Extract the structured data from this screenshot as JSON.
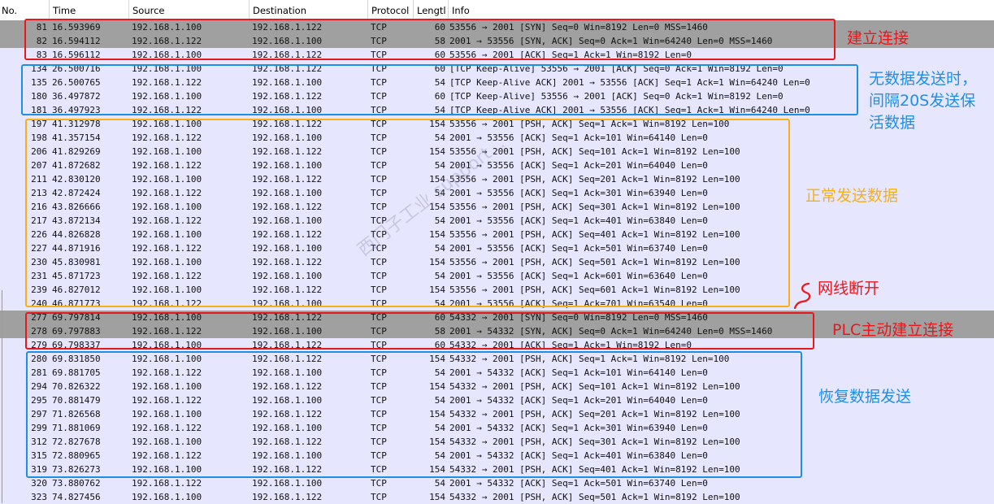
{
  "columns": {
    "no": "No.",
    "time": "Time",
    "source": "Source",
    "destination": "Destination",
    "protocol": "Protocol",
    "length": "Lengtl",
    "info": "Info"
  },
  "rows": [
    {
      "no": "81",
      "time": "16.593969",
      "source": "192.168.1.100",
      "destination": "192.168.1.122",
      "protocol": "TCP",
      "length": "60",
      "info": "53556 → 2001 [SYN] Seq=0 Win=8192 Len=0 MSS=1460",
      "style": "syn"
    },
    {
      "no": "82",
      "time": "16.594112",
      "source": "192.168.1.122",
      "destination": "192.168.1.100",
      "protocol": "TCP",
      "length": "58",
      "info": "2001 → 53556 [SYN, ACK] Seq=0 Ack=1 Win=64240 Len=0 MSS=1460",
      "style": "syn"
    },
    {
      "no": "83",
      "time": "16.596112",
      "source": "192.168.1.100",
      "destination": "192.168.1.122",
      "protocol": "TCP",
      "length": "60",
      "info": "53556 → 2001 [ACK] Seq=1 Ack=1 Win=8192 Len=0",
      "style": "tcp"
    },
    {
      "no": "134",
      "time": "26.500716",
      "source": "192.168.1.100",
      "destination": "192.168.1.122",
      "protocol": "TCP",
      "length": "60",
      "info": "[TCP Keep-Alive] 53556 → 2001 [ACK] Seq=0 Ack=1 Win=8192 Len=0",
      "style": "ka"
    },
    {
      "no": "135",
      "time": "26.500765",
      "source": "192.168.1.122",
      "destination": "192.168.1.100",
      "protocol": "TCP",
      "length": "54",
      "info": "[TCP Keep-Alive ACK] 2001 → 53556 [ACK] Seq=1 Ack=1 Win=64240 Len=0",
      "style": "ka"
    },
    {
      "no": "180",
      "time": "36.497872",
      "source": "192.168.1.100",
      "destination": "192.168.1.122",
      "protocol": "TCP",
      "length": "60",
      "info": "[TCP Keep-Alive] 53556 → 2001 [ACK] Seq=0 Ack=1 Win=8192 Len=0",
      "style": "ka"
    },
    {
      "no": "181",
      "time": "36.497923",
      "source": "192.168.1.122",
      "destination": "192.168.1.100",
      "protocol": "TCP",
      "length": "54",
      "info": "[TCP Keep-Alive ACK] 2001 → 53556 [ACK] Seq=1 Ack=1 Win=64240 Len=0",
      "style": "ka"
    },
    {
      "no": "197",
      "time": "41.312978",
      "source": "192.168.1.100",
      "destination": "192.168.1.122",
      "protocol": "TCP",
      "length": "154",
      "info": "53556 → 2001 [PSH, ACK] Seq=1 Ack=1 Win=8192 Len=100",
      "style": "tcp"
    },
    {
      "no": "198",
      "time": "41.357154",
      "source": "192.168.1.122",
      "destination": "192.168.1.100",
      "protocol": "TCP",
      "length": "54",
      "info": "2001 → 53556 [ACK] Seq=1 Ack=101 Win=64140 Len=0",
      "style": "tcp"
    },
    {
      "no": "206",
      "time": "41.829269",
      "source": "192.168.1.100",
      "destination": "192.168.1.122",
      "protocol": "TCP",
      "length": "154",
      "info": "53556 → 2001 [PSH, ACK] Seq=101 Ack=1 Win=8192 Len=100",
      "style": "tcp"
    },
    {
      "no": "207",
      "time": "41.872682",
      "source": "192.168.1.122",
      "destination": "192.168.1.100",
      "protocol": "TCP",
      "length": "54",
      "info": "2001 → 53556 [ACK] Seq=1 Ack=201 Win=64040 Len=0",
      "style": "tcp"
    },
    {
      "no": "211",
      "time": "42.830120",
      "source": "192.168.1.100",
      "destination": "192.168.1.122",
      "protocol": "TCP",
      "length": "154",
      "info": "53556 → 2001 [PSH, ACK] Seq=201 Ack=1 Win=8192 Len=100",
      "style": "tcp"
    },
    {
      "no": "213",
      "time": "42.872424",
      "source": "192.168.1.122",
      "destination": "192.168.1.100",
      "protocol": "TCP",
      "length": "54",
      "info": "2001 → 53556 [ACK] Seq=1 Ack=301 Win=63940 Len=0",
      "style": "tcp"
    },
    {
      "no": "216",
      "time": "43.826666",
      "source": "192.168.1.100",
      "destination": "192.168.1.122",
      "protocol": "TCP",
      "length": "154",
      "info": "53556 → 2001 [PSH, ACK] Seq=301 Ack=1 Win=8192 Len=100",
      "style": "tcp"
    },
    {
      "no": "217",
      "time": "43.872134",
      "source": "192.168.1.122",
      "destination": "192.168.1.100",
      "protocol": "TCP",
      "length": "54",
      "info": "2001 → 53556 [ACK] Seq=1 Ack=401 Win=63840 Len=0",
      "style": "tcp"
    },
    {
      "no": "226",
      "time": "44.826828",
      "source": "192.168.1.100",
      "destination": "192.168.1.122",
      "protocol": "TCP",
      "length": "154",
      "info": "53556 → 2001 [PSH, ACK] Seq=401 Ack=1 Win=8192 Len=100",
      "style": "tcp"
    },
    {
      "no": "227",
      "time": "44.871916",
      "source": "192.168.1.122",
      "destination": "192.168.1.100",
      "protocol": "TCP",
      "length": "54",
      "info": "2001 → 53556 [ACK] Seq=1 Ack=501 Win=63740 Len=0",
      "style": "tcp"
    },
    {
      "no": "230",
      "time": "45.830981",
      "source": "192.168.1.100",
      "destination": "192.168.1.122",
      "protocol": "TCP",
      "length": "154",
      "info": "53556 → 2001 [PSH, ACK] Seq=501 Ack=1 Win=8192 Len=100",
      "style": "tcp"
    },
    {
      "no": "231",
      "time": "45.871723",
      "source": "192.168.1.122",
      "destination": "192.168.1.100",
      "protocol": "TCP",
      "length": "54",
      "info": "2001 → 53556 [ACK] Seq=1 Ack=601 Win=63640 Len=0",
      "style": "tcp"
    },
    {
      "no": "239",
      "time": "46.827012",
      "source": "192.168.1.100",
      "destination": "192.168.1.122",
      "protocol": "TCP",
      "length": "154",
      "info": "53556 → 2001 [PSH, ACK] Seq=601 Ack=1 Win=8192 Len=100",
      "style": "tcp"
    },
    {
      "no": "240",
      "time": "46.871773",
      "source": "192.168.1.122",
      "destination": "192.168.1.100",
      "protocol": "TCP",
      "length": "54",
      "info": "2001 → 53556 [ACK] Seq=1 Ack=701 Win=63540 Len=0",
      "style": "tcp"
    },
    {
      "no": "277",
      "time": "69.797814",
      "source": "192.168.1.100",
      "destination": "192.168.1.122",
      "protocol": "TCP",
      "length": "60",
      "info": "54332 → 2001 [SYN] Seq=0 Win=8192 Len=0 MSS=1460",
      "style": "syn"
    },
    {
      "no": "278",
      "time": "69.797883",
      "source": "192.168.1.122",
      "destination": "192.168.1.100",
      "protocol": "TCP",
      "length": "58",
      "info": "2001 → 54332 [SYN, ACK] Seq=0 Ack=1 Win=64240 Len=0 MSS=1460",
      "style": "syn"
    },
    {
      "no": "279",
      "time": "69.798337",
      "source": "192.168.1.100",
      "destination": "192.168.1.122",
      "protocol": "TCP",
      "length": "60",
      "info": "54332 → 2001 [ACK] Seq=1 Ack=1 Win=8192 Len=0",
      "style": "tcp"
    },
    {
      "no": "280",
      "time": "69.831850",
      "source": "192.168.1.100",
      "destination": "192.168.1.122",
      "protocol": "TCP",
      "length": "154",
      "info": "54332 → 2001 [PSH, ACK] Seq=1 Ack=1 Win=8192 Len=100",
      "style": "tcp"
    },
    {
      "no": "281",
      "time": "69.881705",
      "source": "192.168.1.122",
      "destination": "192.168.1.100",
      "protocol": "TCP",
      "length": "54",
      "info": "2001 → 54332 [ACK] Seq=1 Ack=101 Win=64140 Len=0",
      "style": "tcp"
    },
    {
      "no": "294",
      "time": "70.826322",
      "source": "192.168.1.100",
      "destination": "192.168.1.122",
      "protocol": "TCP",
      "length": "154",
      "info": "54332 → 2001 [PSH, ACK] Seq=101 Ack=1 Win=8192 Len=100",
      "style": "tcp"
    },
    {
      "no": "295",
      "time": "70.881479",
      "source": "192.168.1.122",
      "destination": "192.168.1.100",
      "protocol": "TCP",
      "length": "54",
      "info": "2001 → 54332 [ACK] Seq=1 Ack=201 Win=64040 Len=0",
      "style": "tcp"
    },
    {
      "no": "297",
      "time": "71.826568",
      "source": "192.168.1.100",
      "destination": "192.168.1.122",
      "protocol": "TCP",
      "length": "154",
      "info": "54332 → 2001 [PSH, ACK] Seq=201 Ack=1 Win=8192 Len=100",
      "style": "tcp"
    },
    {
      "no": "299",
      "time": "71.881069",
      "source": "192.168.1.122",
      "destination": "192.168.1.100",
      "protocol": "TCP",
      "length": "54",
      "info": "2001 → 54332 [ACK] Seq=1 Ack=301 Win=63940 Len=0",
      "style": "tcp"
    },
    {
      "no": "312",
      "time": "72.827678",
      "source": "192.168.1.100",
      "destination": "192.168.1.122",
      "protocol": "TCP",
      "length": "154",
      "info": "54332 → 2001 [PSH, ACK] Seq=301 Ack=1 Win=8192 Len=100",
      "style": "tcp"
    },
    {
      "no": "315",
      "time": "72.880965",
      "source": "192.168.1.122",
      "destination": "192.168.1.100",
      "protocol": "TCP",
      "length": "54",
      "info": "2001 → 54332 [ACK] Seq=1 Ack=401 Win=63840 Len=0",
      "style": "tcp"
    },
    {
      "no": "319",
      "time": "73.826273",
      "source": "192.168.1.100",
      "destination": "192.168.1.122",
      "protocol": "TCP",
      "length": "154",
      "info": "54332 → 2001 [PSH, ACK] Seq=401 Ack=1 Win=8192 Len=100",
      "style": "tcp"
    },
    {
      "no": "320",
      "time": "73.880762",
      "source": "192.168.1.122",
      "destination": "192.168.1.100",
      "protocol": "TCP",
      "length": "54",
      "info": "2001 → 54332 [ACK] Seq=1 Ack=501 Win=63740 Len=0",
      "style": "tcp"
    },
    {
      "no": "323",
      "time": "74.827456",
      "source": "192.168.1.100",
      "destination": "192.168.1.122",
      "protocol": "TCP",
      "length": "154",
      "info": "54332 → 2001 [PSH, ACK] Seq=501 Ack=1 Win=8192 Len=100",
      "style": "tcp"
    }
  ],
  "annotations": {
    "connect": "建立连接",
    "keepalive_line1": "无数据发送时，",
    "keepalive_line2": "间隔20S发送保",
    "keepalive_line3": "活数据",
    "normal_send": "正常发送数据",
    "cable_break": "网线断开",
    "plc_reconnect": "PLC主动建立连接",
    "resume_send": "恢复数据发送"
  },
  "watermark": "西门子工业 support...",
  "colors": {
    "red": "#e8171b",
    "blue": "#1f8fe6",
    "orange": "#f5b114",
    "syn_row": "#a0a0a0",
    "tcp_row": "#e7e6ff"
  }
}
